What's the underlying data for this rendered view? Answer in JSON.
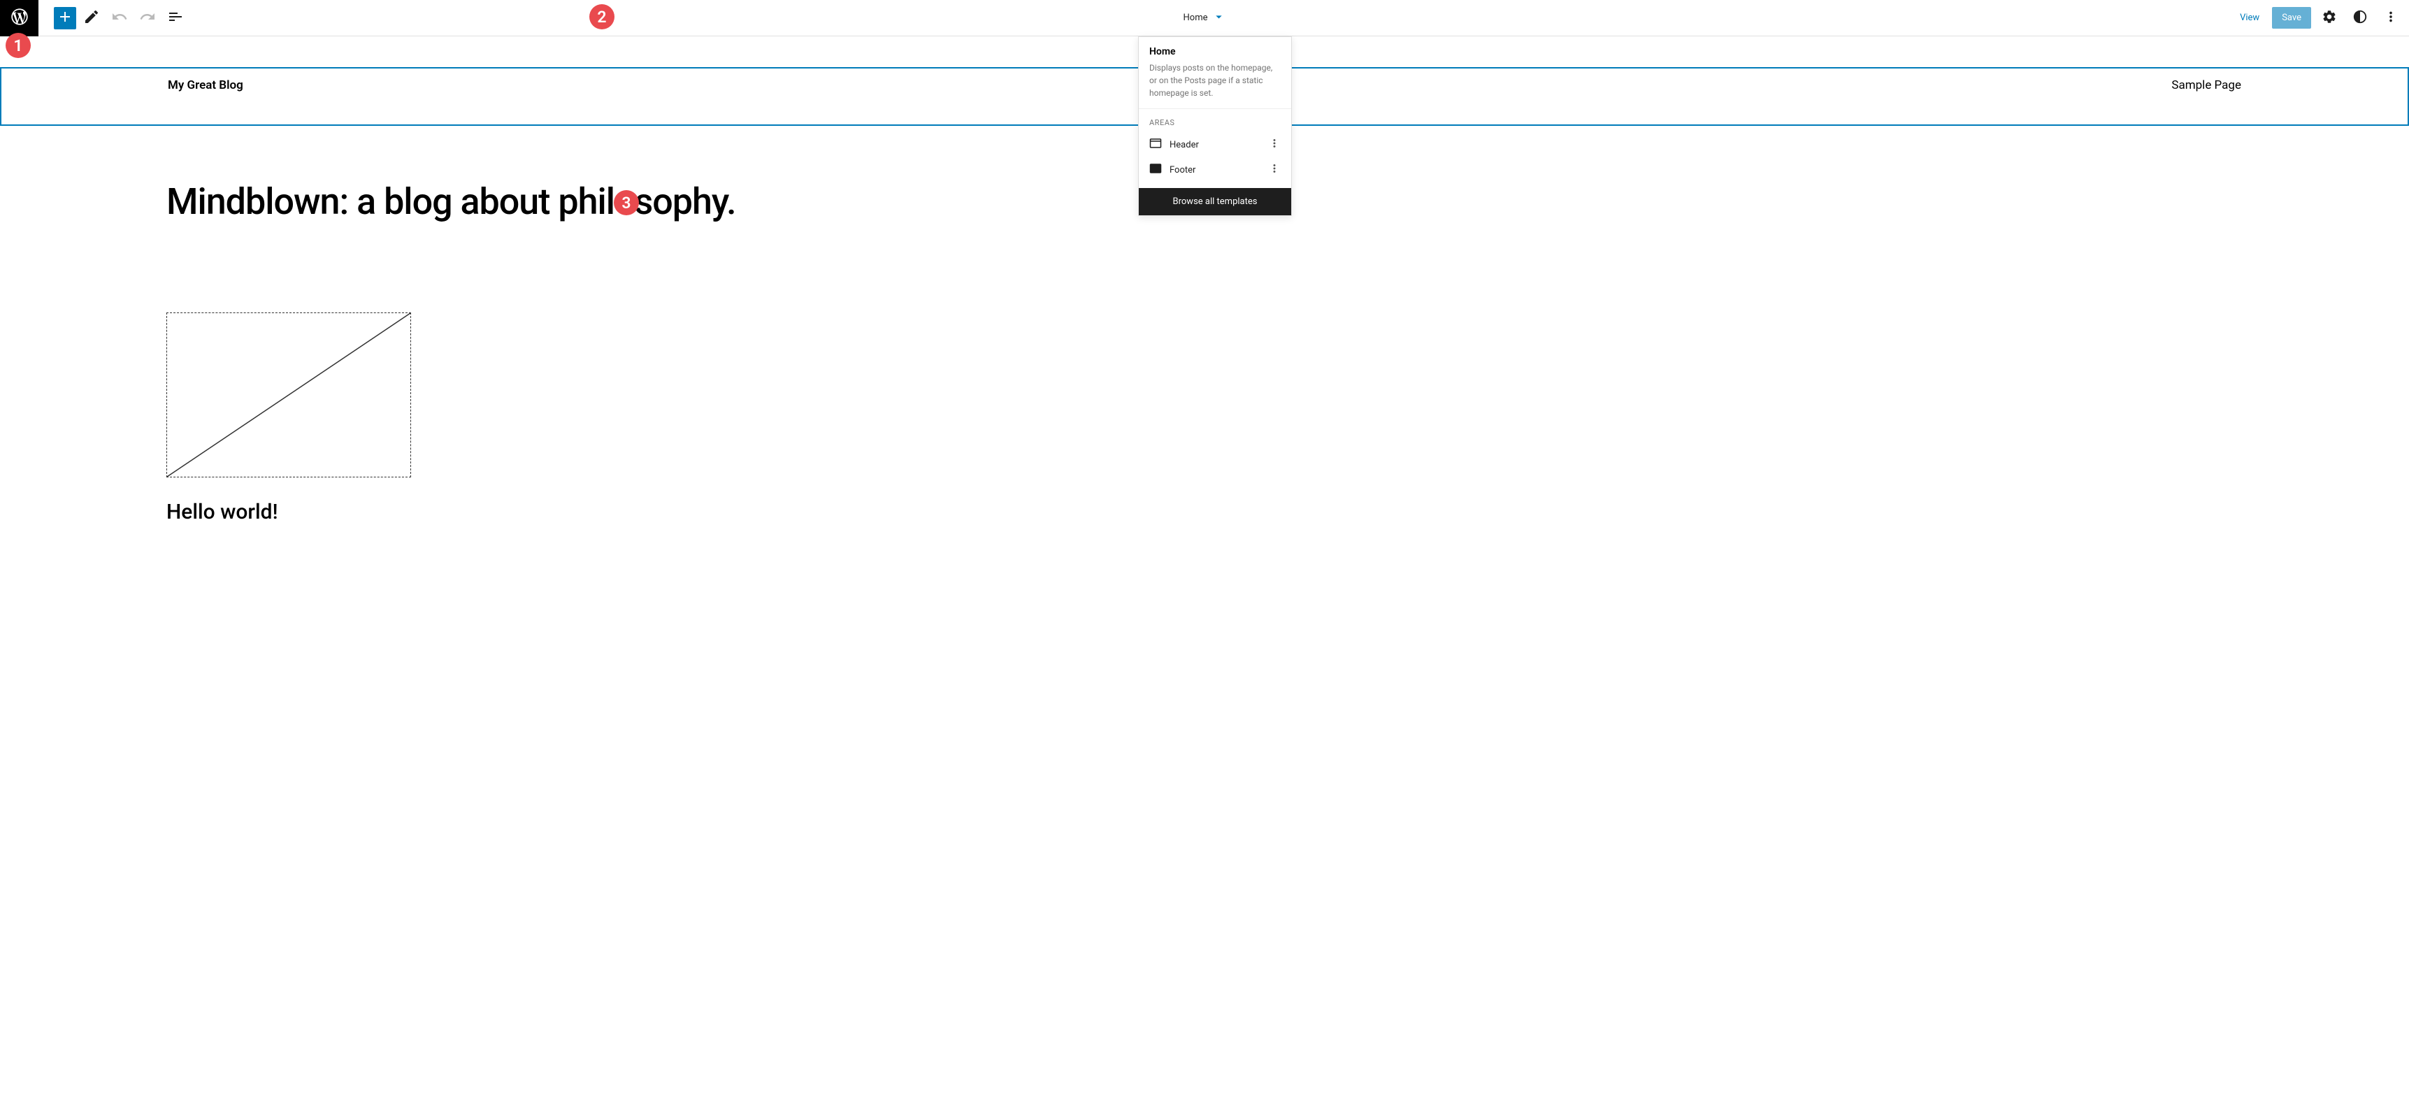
{
  "toolbar": {
    "template_name": "Home",
    "view_label": "View",
    "save_label": "Save"
  },
  "dropdown": {
    "title": "Home",
    "description": "Displays posts on the homepage, or on the Posts page if a static homepage is set.",
    "areas_label": "AREAS",
    "areas": [
      {
        "label": "Header"
      },
      {
        "label": "Footer"
      }
    ],
    "browse_label": "Browse all templates"
  },
  "site": {
    "title": "My Great Blog",
    "nav_link": "Sample Page"
  },
  "content": {
    "heading": "Mindblown: a blog about philosophy.",
    "post_title": "Hello world!"
  },
  "annotations": {
    "badge1": "1",
    "badge2": "2",
    "badge3": "3"
  }
}
